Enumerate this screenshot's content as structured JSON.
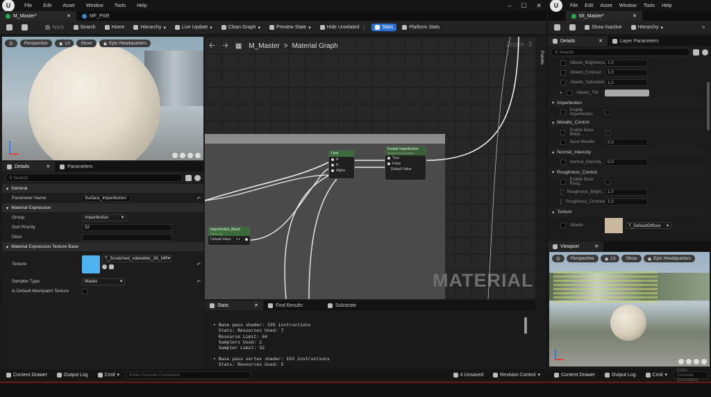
{
  "main_window": {
    "menu": [
      "File",
      "Edit",
      "Asset",
      "Window",
      "Tools",
      "Help"
    ],
    "tabs": [
      {
        "label": "M_Master*"
      },
      {
        "label": "MF_PSR"
      }
    ],
    "toolbar": [
      "Apply",
      "Search",
      "Home",
      "Hierarchy",
      "Live Update",
      "Clean Graph",
      "Preview State",
      "Hide Unrelated",
      "Stats",
      "Platform Stats"
    ],
    "viewport": {
      "buttons": [
        "Perspective",
        "Lit",
        "Show",
        "Epic Headquarters"
      ]
    },
    "details": {
      "tabs": [
        "Details",
        "Parameters"
      ],
      "search_placeholder": "Search",
      "sections": {
        "general": "General",
        "material_expression": "Material Expression",
        "texture_base": "Material Expression Texture Base"
      },
      "parameter_name": {
        "label": "Parameter Name",
        "value": "Surface_Imperfection"
      },
      "group": {
        "label": "Group",
        "value": "Imperfection"
      },
      "sort_priority": {
        "label": "Sort Priority",
        "value": "32"
      },
      "desc": {
        "label": "Desc",
        "value": ""
      },
      "texture": {
        "label": "Texture",
        "value": "T_Scratched_vdekebbc_2K_MR"
      },
      "sampler_type": {
        "label": "Sampler Type",
        "value": "Masks"
      },
      "is_default_meshpaint": {
        "label": "Is Default Meshpaint Texture"
      }
    },
    "graph": {
      "breadcrumb": [
        "M_Master",
        "Material Graph"
      ],
      "zoom": "Zoom -3",
      "palette": "Palette",
      "watermark": "MATERIAL",
      "nodes": {
        "lerp": {
          "title": "Lerp",
          "pins": [
            "A",
            "B",
            "Alpha"
          ]
        },
        "switch": {
          "title": "Enable Imperfection",
          "subtitle": "Switch Param (False)",
          "pins": [
            "True",
            "False",
            "Default Value"
          ]
        },
        "texparam": {
          "title": "Imperfection_Blend",
          "subtitle": "Param (0)",
          "pin": "Default Value",
          "pin_value": "0.5"
        }
      }
    },
    "stats": {
      "tabs": [
        "Stats",
        "Find Results",
        "Substrate"
      ],
      "lines": [
        "• Base pass shader: 335 instructions",
        "  Stats: Resources Used: 7",
        "  Resource Limit: 64",
        "  Samplers Used: 2",
        "  Sampler Limit: 32",
        "",
        "• Base pass vertex shader: 153 instructions",
        "  Stats: Resources Used: 5"
      ]
    },
    "statusbar": {
      "content_drawer": "Content Drawer",
      "output_log": "Output Log",
      "cmd": "Cmd",
      "console_placeholder": "Enter Console Command",
      "unsaved": "4 Unsaved",
      "revision": "Revision Control"
    }
  },
  "instance_window": {
    "menu": [
      "File",
      "Edit",
      "Asset",
      "Window",
      "Tools",
      "Help"
    ],
    "tab": "MI_Master*",
    "toolbar": [
      "Show Inactive",
      "Hierarchy"
    ],
    "panel_tabs": [
      "Details",
      "Layer Parameters"
    ],
    "search_placeholder": "Search",
    "rows": [
      {
        "type": "prop",
        "label": "Albedo_Brightness",
        "value": "1.0"
      },
      {
        "type": "prop",
        "label": "Albedo_Contrast",
        "value": "1.0"
      },
      {
        "type": "prop",
        "label": "Albedo_Saturation",
        "value": "1.0"
      },
      {
        "type": "tint",
        "label": "Albedo_Tint",
        "value": ""
      },
      {
        "type": "cat",
        "label": "Imperfection"
      },
      {
        "type": "check",
        "label": "Enable Imperfection",
        "value": ""
      },
      {
        "type": "cat",
        "label": "Metallic_Control"
      },
      {
        "type": "check",
        "label": "Enable Base Metal...",
        "value": "✓"
      },
      {
        "type": "prop",
        "label": "Base Metallic",
        "value": "0.0"
      },
      {
        "type": "cat",
        "label": "Normal_Intensity"
      },
      {
        "type": "prop",
        "label": "Normal_Intensity",
        "value": "0.0"
      },
      {
        "type": "cat",
        "label": "Roughness_Control"
      },
      {
        "type": "check",
        "label": "Enable Base Roug...",
        "value": ""
      },
      {
        "type": "prop",
        "label": "Roughness_Bright...",
        "value": "1.0"
      },
      {
        "type": "prop",
        "label": "Roughness_Contrast",
        "value": "1.0"
      },
      {
        "type": "cat",
        "label": "Texture"
      }
    ],
    "albedo": {
      "label": "Albedo",
      "value": "T_DefaultDiffuse"
    },
    "viewport": {
      "title": "Viewport",
      "buttons": [
        "Perspective",
        "Lit",
        "Show",
        "Epic Headquarters"
      ]
    },
    "statusbar": {
      "content_drawer": "Content Drawer",
      "output_log": "Output Log",
      "cmd": "Cmd",
      "console_placeholder": "Enter Console Command"
    }
  },
  "colors": {
    "accent_blue": "#2a6fd6",
    "texture_thumb": "#4fb3f0",
    "tint_swatch": "#a8a8a8"
  }
}
